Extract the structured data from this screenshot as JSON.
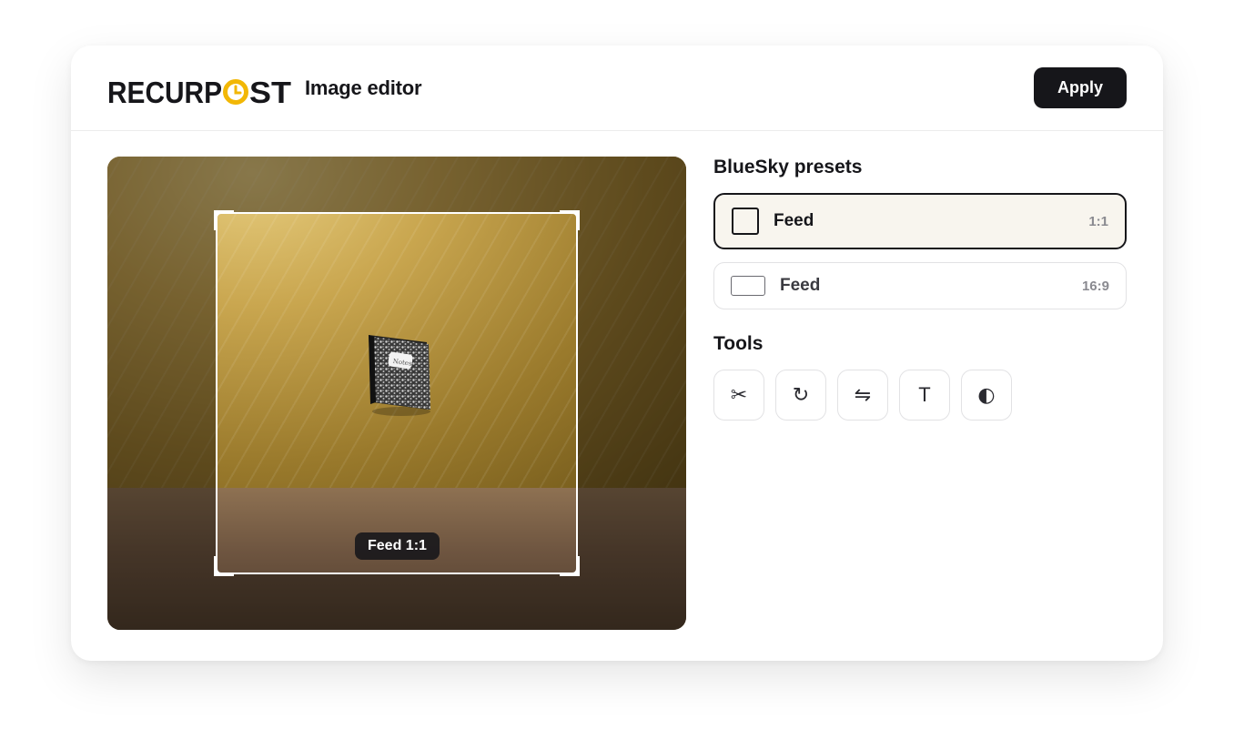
{
  "header": {
    "logo_text": "RECURPOST",
    "title": "Image editor",
    "apply_label": "Apply"
  },
  "canvas": {
    "crop_label": "Feed 1:1",
    "object_label": "Notes"
  },
  "presets": {
    "title": "BlueSky presets",
    "items": [
      {
        "name": "Feed",
        "ratio": "1:1",
        "selected": true
      },
      {
        "name": "Feed",
        "ratio": "16:9",
        "selected": false
      }
    ]
  },
  "tools": {
    "title": "Tools",
    "items": [
      {
        "icon": "scissors-icon",
        "glyph": "✂"
      },
      {
        "icon": "rotate-icon",
        "glyph": "↻"
      },
      {
        "icon": "flip-icon",
        "glyph": "⇋"
      },
      {
        "icon": "text-icon",
        "glyph": "T"
      },
      {
        "icon": "contrast-icon",
        "glyph": "◐"
      }
    ]
  },
  "colors": {
    "primary": "#16161a",
    "accent": "#f2b705",
    "selected_bg": "#f8f5ee",
    "border": "#e2e2e4"
  }
}
